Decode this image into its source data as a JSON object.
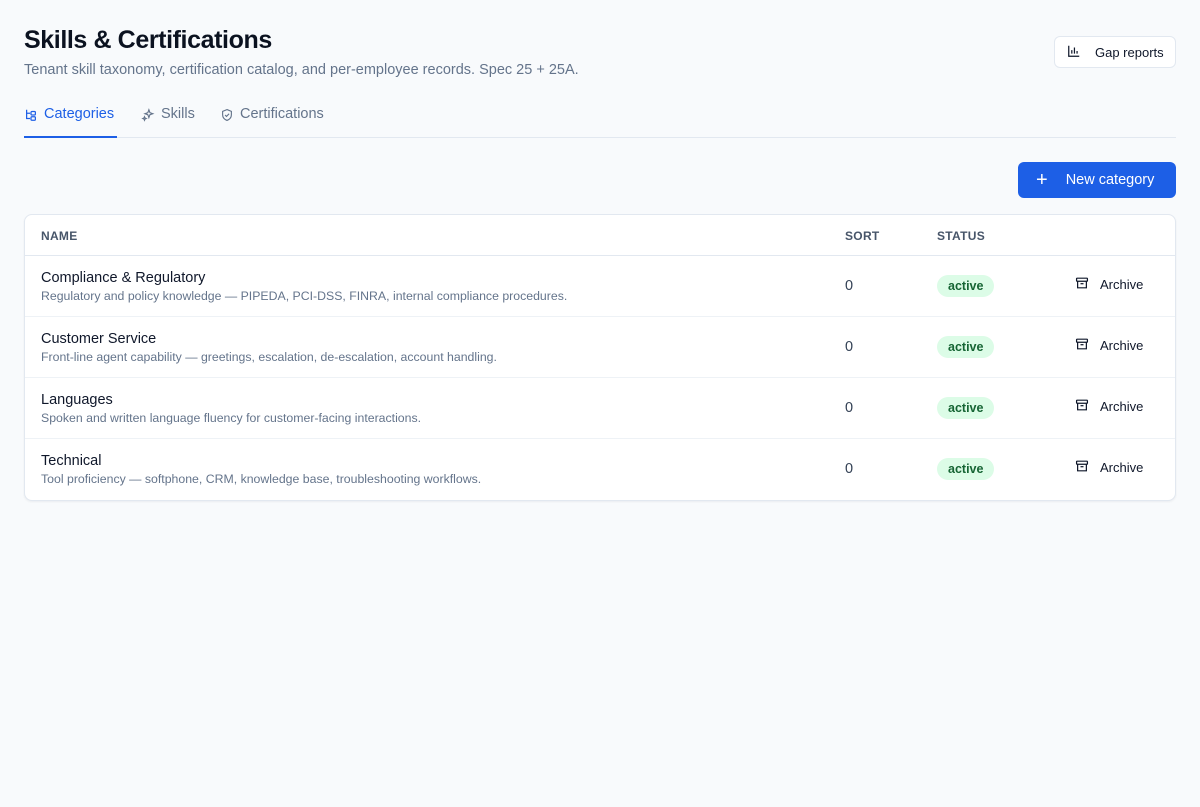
{
  "header": {
    "title": "Skills & Certifications",
    "subtitle": "Tenant skill taxonomy, certification catalog, and per-employee records. Spec 25 + 25A.",
    "gap_reports_label": "Gap reports"
  },
  "tabs": [
    {
      "label": "Categories",
      "icon": "hierarchy-icon",
      "active": true
    },
    {
      "label": "Skills",
      "icon": "sparkles-icon",
      "active": false
    },
    {
      "label": "Certifications",
      "icon": "shield-icon",
      "active": false
    }
  ],
  "actions": {
    "new_category_label": "New category"
  },
  "table": {
    "columns": [
      "NAME",
      "SORT",
      "STATUS"
    ],
    "rows": [
      {
        "name": "Compliance & Regulatory",
        "description": "Regulatory and policy knowledge — PIPEDA, PCI-DSS, FINRA, internal compliance procedures.",
        "sort": "0",
        "status": "active",
        "action": "Archive"
      },
      {
        "name": "Customer Service",
        "description": "Front-line agent capability — greetings, escalation, de-escalation, account handling.",
        "sort": "0",
        "status": "active",
        "action": "Archive"
      },
      {
        "name": "Languages",
        "description": "Spoken and written language fluency for customer-facing interactions.",
        "sort": "0",
        "status": "active",
        "action": "Archive"
      },
      {
        "name": "Technical",
        "description": "Tool proficiency — softphone, CRM, knowledge base, troubleshooting workflows.",
        "sort": "0",
        "status": "active",
        "action": "Archive"
      }
    ]
  },
  "colors": {
    "primary": "#1d5fe6",
    "status_active_bg": "#dcfce7",
    "status_active_text": "#166534"
  }
}
